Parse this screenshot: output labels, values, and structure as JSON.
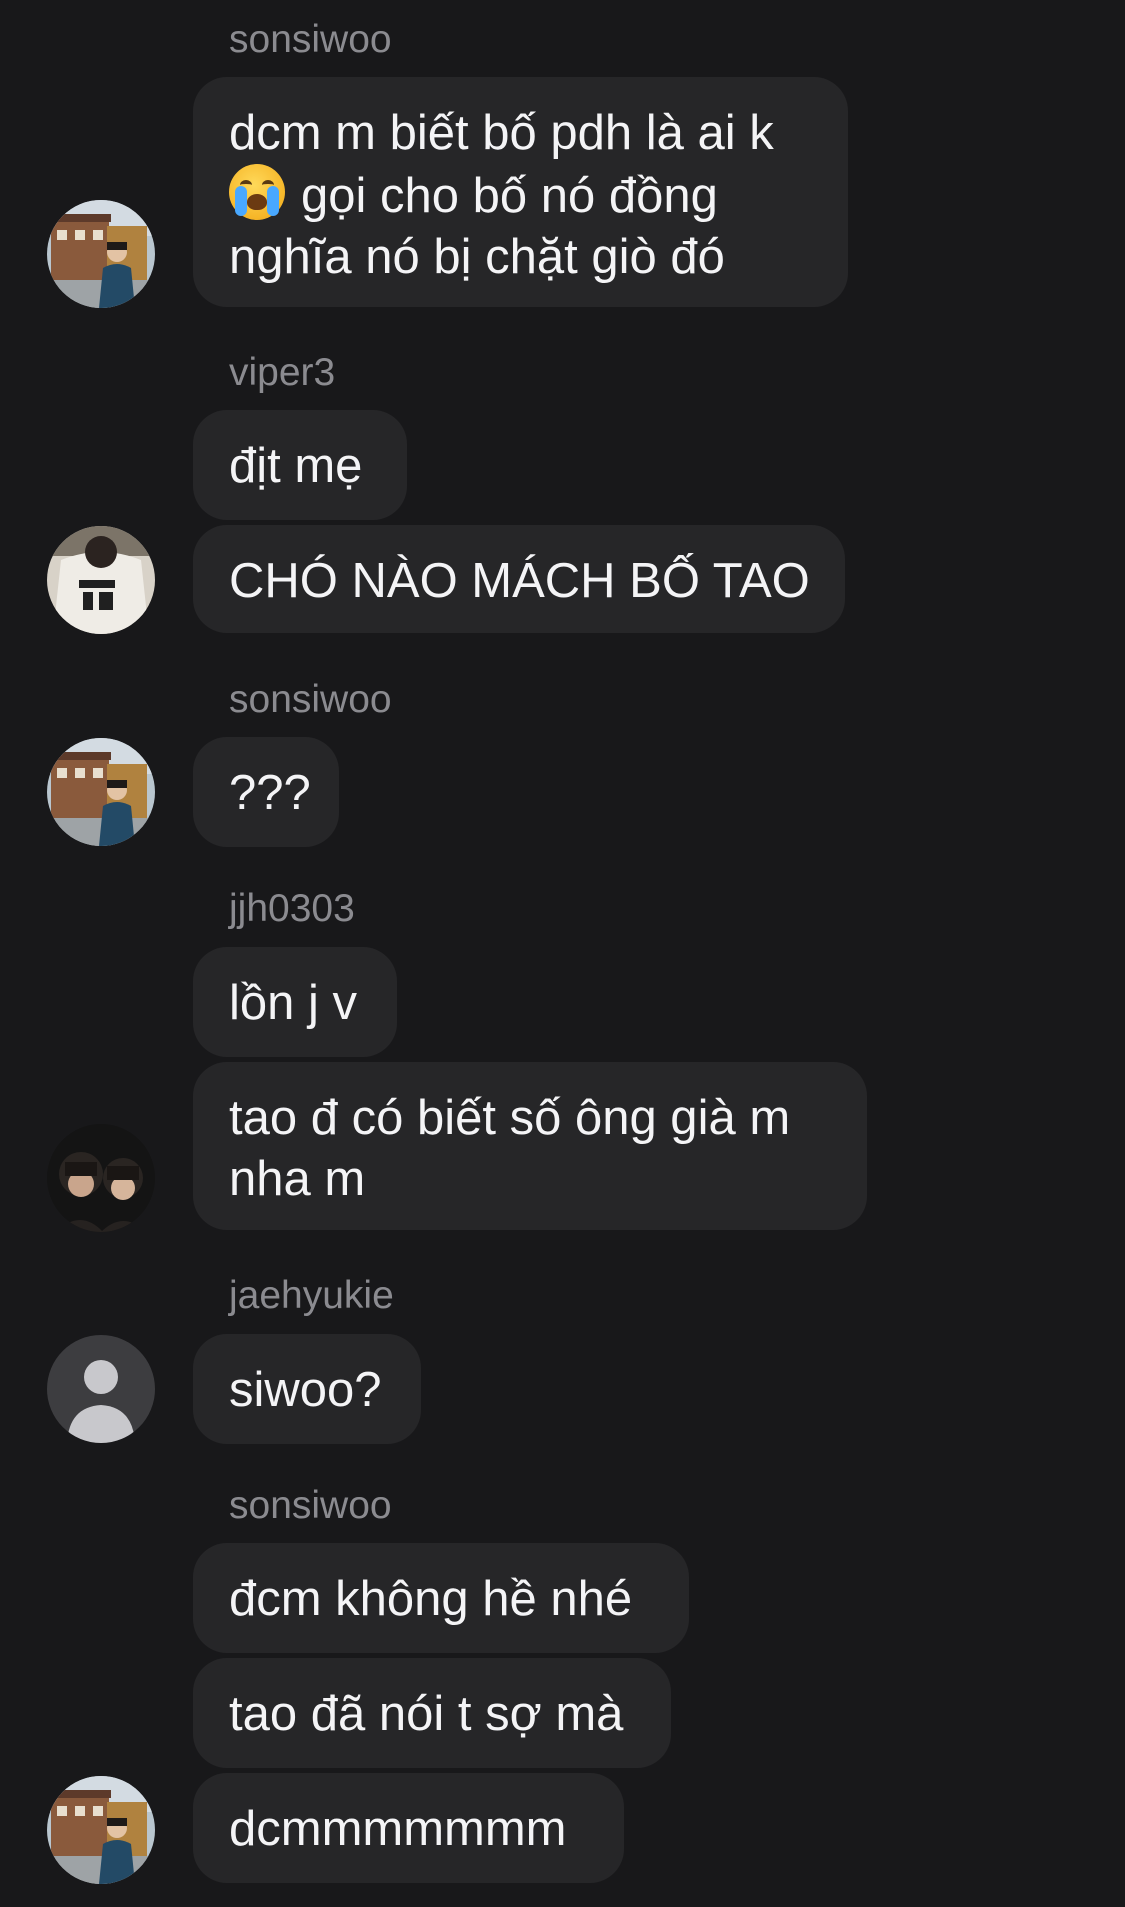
{
  "chat": {
    "senders": [
      "sonsiwoo",
      "viper3",
      "sonsiwoo",
      "jjh0303",
      "jaehyukie",
      "sonsiwoo"
    ],
    "messages": {
      "m1": [
        "dcm m biết bố pdh là ai k",
        "gọi cho bố nó đồng",
        "nghĩa nó bị chặt giò đó"
      ],
      "m1_emoji": "loudly-crying-face-emoji",
      "m2": "địt mẹ",
      "m3": "CHÓ NÀO MÁCH BỐ TAO",
      "m4": "???",
      "m5": "lồn j v",
      "m6": [
        "tao đ có biết số ông già m",
        "nha m"
      ],
      "m7": "siwoo?",
      "m8": "đcm không hề nhé",
      "m9": "tao đã nói t sợ mà",
      "m10": "dcmmmmmmm"
    },
    "avatars": [
      "sonsiwoo-avatar",
      "viper3-avatar",
      "sonsiwoo-avatar",
      "jjh0303-avatar",
      "default-user-icon",
      "sonsiwoo-avatar"
    ],
    "colors": {
      "background": "#18181a",
      "bubble": "#262628",
      "text": "#f4f4f6",
      "sender": "#8b8b90"
    }
  }
}
